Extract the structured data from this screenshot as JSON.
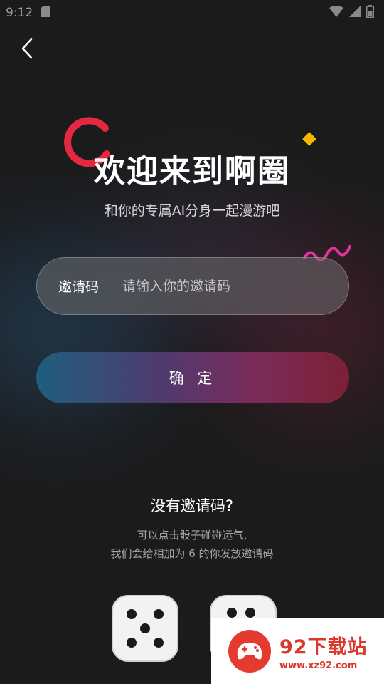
{
  "status_bar": {
    "time": "9:12"
  },
  "header": {
    "title": "欢迎来到啊圈",
    "subtitle": "和你的专属AI分身一起漫游吧"
  },
  "invite": {
    "label": "邀请码",
    "placeholder": "请输入你的邀请码",
    "value": ""
  },
  "confirm_button": {
    "label": "确 定"
  },
  "no_code": {
    "title": "没有邀请码?",
    "hint_line1": "可以点击骰子碰碰运气,",
    "hint_line2": "我们会给相加为 6 的你发放邀请码"
  },
  "dice": [
    {
      "face": 5
    },
    {
      "face": 4
    }
  ],
  "watermark": {
    "name": "92下载站",
    "url": "www.xz92.com"
  },
  "colors": {
    "background": "#1b1b1c",
    "accent_ring": "#e4283f",
    "accent_diamond": "#f5b700",
    "button_gradient_start": "#1f5e7e",
    "button_gradient_end": "#7d2036"
  }
}
